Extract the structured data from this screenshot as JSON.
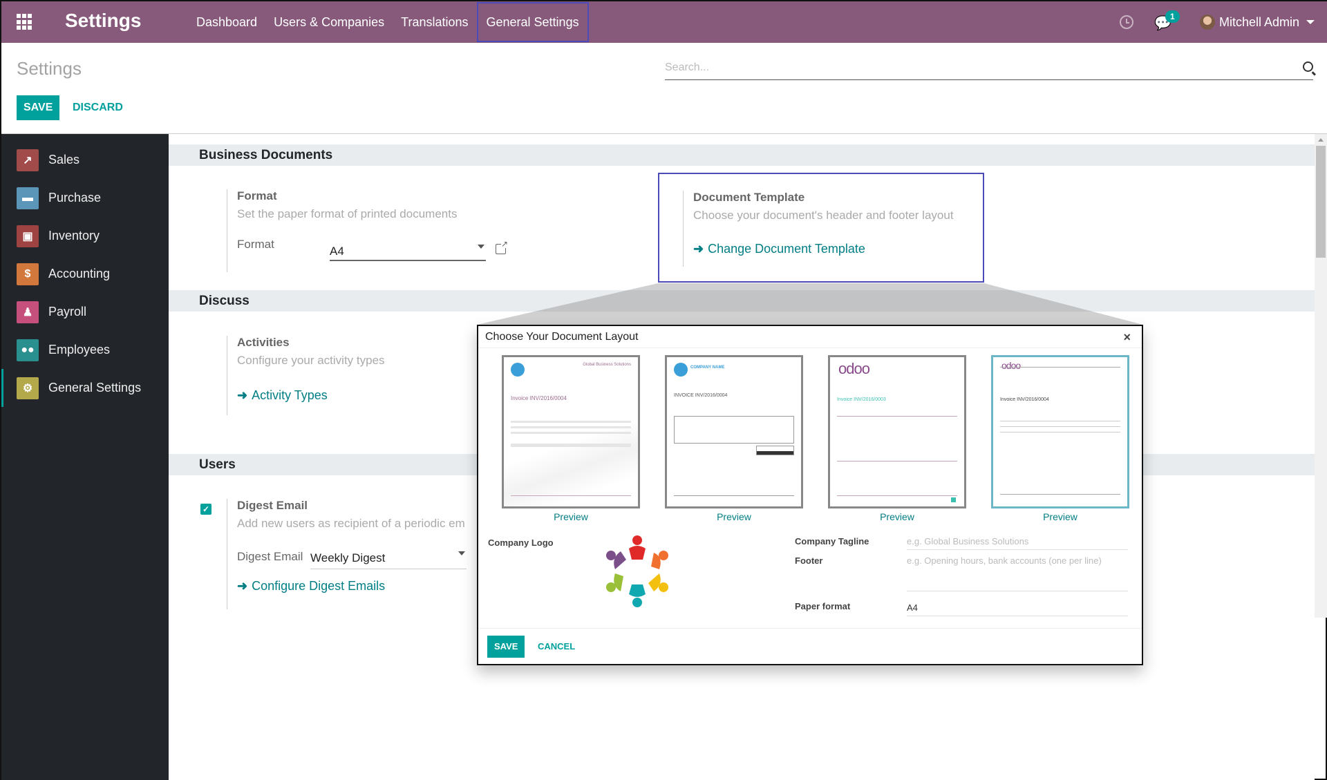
{
  "navbar": {
    "app_title": "Settings",
    "menu": [
      "Dashboard",
      "Users & Companies",
      "Translations",
      "General Settings"
    ],
    "active_menu": "General Settings",
    "messages_count": "1",
    "user_name": "Mitchell Admin"
  },
  "control_panel": {
    "title": "Settings",
    "save_label": "SAVE",
    "discard_label": "DISCARD",
    "search_placeholder": "Search..."
  },
  "sidebar": {
    "items": [
      {
        "label": "Sales",
        "icon": "sales-chart-icon",
        "color": "#a24b4b"
      },
      {
        "label": "Purchase",
        "icon": "credit-card-icon",
        "color": "#5b95b8"
      },
      {
        "label": "Inventory",
        "icon": "box-icon",
        "color": "#9e4242"
      },
      {
        "label": "Accounting",
        "icon": "invoice-dollar-icon",
        "color": "#d2783c"
      },
      {
        "label": "Payroll",
        "icon": "payroll-icon",
        "color": "#c5507b"
      },
      {
        "label": "Employees",
        "icon": "users-icon",
        "color": "#2a8f8f"
      },
      {
        "label": "General Settings",
        "icon": "gear-icon",
        "color": "#b3a94a"
      }
    ],
    "active": "General Settings"
  },
  "sections": {
    "business_documents": {
      "title": "Business Documents",
      "format": {
        "heading": "Format",
        "description": "Set the paper format of printed documents",
        "field_label": "Format",
        "value": "A4"
      },
      "document_template": {
        "heading": "Document Template",
        "description": "Choose your document's header and footer layout",
        "link": "Change Document Template"
      }
    },
    "discuss": {
      "title": "Discuss",
      "activities": {
        "heading": "Activities",
        "description": "Configure your activity types",
        "link": "Activity Types"
      }
    },
    "users": {
      "title": "Users",
      "digest": {
        "checked": true,
        "heading": "Digest Email",
        "description": "Add new users as recipient of a periodic em",
        "field_label": "Digest Email",
        "value": "Weekly Digest",
        "link": "Configure Digest Emails"
      }
    }
  },
  "modal": {
    "title": "Choose Your Document Layout",
    "layouts": [
      {
        "name": "background",
        "preview_label": "Preview",
        "header_text": "Global Business Solutions",
        "invoice_text": "Invoice INV/2016/0004",
        "selected": false
      },
      {
        "name": "boxed",
        "preview_label": "Preview",
        "header_text": "COMPANY NAME",
        "invoice_text": "INVOICE INV/2016/0004",
        "selected": false
      },
      {
        "name": "clean",
        "preview_label": "Preview",
        "header_text": "odoo",
        "invoice_text": "Invoice INV/2016/0003",
        "selected": false
      },
      {
        "name": "standard",
        "preview_label": "Preview",
        "header_text": "odoo",
        "invoice_text": "Invoice INV/2016/0004",
        "selected": true
      }
    ],
    "company_logo_label": "Company Logo",
    "company_tagline_label": "Company Tagline",
    "company_tagline_placeholder": "e.g. Global Business Solutions",
    "footer_label": "Footer",
    "footer_placeholder": "e.g. Opening hours, bank accounts (one per line)",
    "paper_format_label": "Paper format",
    "paper_format_value": "A4",
    "save_label": "SAVE",
    "cancel_label": "CANCEL"
  }
}
